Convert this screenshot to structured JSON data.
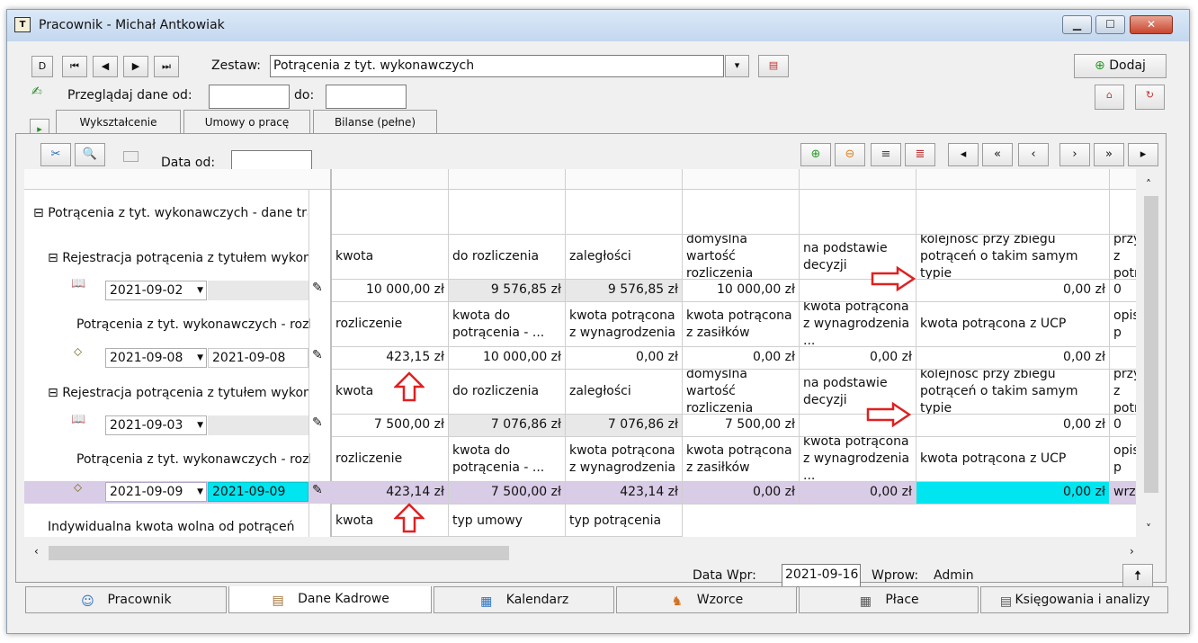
{
  "window": {
    "title": "Pracownik - Michał Antkowiak"
  },
  "toolbar": {
    "nav": [
      "D",
      "K",
      "◂",
      "▸",
      "▸|"
    ],
    "zestaw_label": "Zestaw:",
    "zestaw_value": "Potrącenia z tyt. wykonawczych",
    "dodaj": "Dodaj",
    "przegladaj_label": "Przeglądaj dane od:",
    "do_label": "do:",
    "from_value": "",
    "to_value": ""
  },
  "tabs": [
    "Wykształcenie",
    "Umowy o pracę",
    "Bilanse (pełne)"
  ],
  "grid_toolbar": {
    "data_od_label": "Data od:",
    "data_od_value": ""
  },
  "grid": {
    "section": "Potrącenia z tyt. wykonawczych - dane tran...",
    "reg_label": "Rejestracja potrącenia z tytułem wykona...",
    "potr_label": "Potrącenia z tyt. wykonawczych - rozli...",
    "header1": [
      "kwota",
      "do rozliczenia",
      "zaległości",
      "domyślna wartość rozliczenia",
      "na podstawie decyzji",
      "kolejność przy zbiegu potrąceń o takim samym typie",
      "przy z potrą"
    ],
    "header2": [
      "rozliczenie",
      "kwota do potrącenia - ...",
      "kwota potrącona z wynagrodzenia",
      "kwota potrącona z zasiłków",
      "kwota potrącona z wynagrodzenia ...",
      "kwota potrącona z UCP",
      "opis p"
    ],
    "row1": {
      "date": "2021-09-02",
      "values": [
        "10 000,00 zł",
        "9 576,85 zł",
        "9 576,85 zł",
        "10 000,00 zł",
        "",
        "0,00 zł",
        "0"
      ]
    },
    "row2": {
      "date": "2021-09-08",
      "date2": "2021-09-08",
      "values": [
        "423,15 zł",
        "10 000,00 zł",
        "0,00 zł",
        "0,00 zł",
        "0,00 zł",
        "0,00 zł",
        ""
      ]
    },
    "row3": {
      "date": "2021-09-03",
      "values": [
        "7 500,00 zł",
        "7 076,86 zł",
        "7 076,86 zł",
        "7 500,00 zł",
        "",
        "0,00 zł",
        "0"
      ]
    },
    "row4": {
      "date": "2021-09-09",
      "date2": "2021-09-09",
      "values": [
        "423,14 zł",
        "7 500,00 zł",
        "423,14 zł",
        "0,00 zł",
        "0,00 zł",
        "0,00 zł",
        "wrzes"
      ]
    },
    "ind_label": "Indywidualna kwota wolna od potrąceń",
    "header3": [
      "kwota",
      "typ umowy",
      "typ potrącenia"
    ]
  },
  "footer": {
    "data_wpr_label": "Data Wpr:",
    "data_wpr_value": "2021-09-16",
    "wprow_label": "Wprow:",
    "wprow_value": "Admin"
  },
  "bottom_tabs": [
    "Pracownik",
    "Dane Kadrowe",
    "Kalendarz",
    "Wzorce",
    "Płace",
    "Księgowania i analizy"
  ],
  "colors": {
    "selected_row": "#d9cce6",
    "cyan": "#00e5f0",
    "arrow": "#e02020"
  }
}
